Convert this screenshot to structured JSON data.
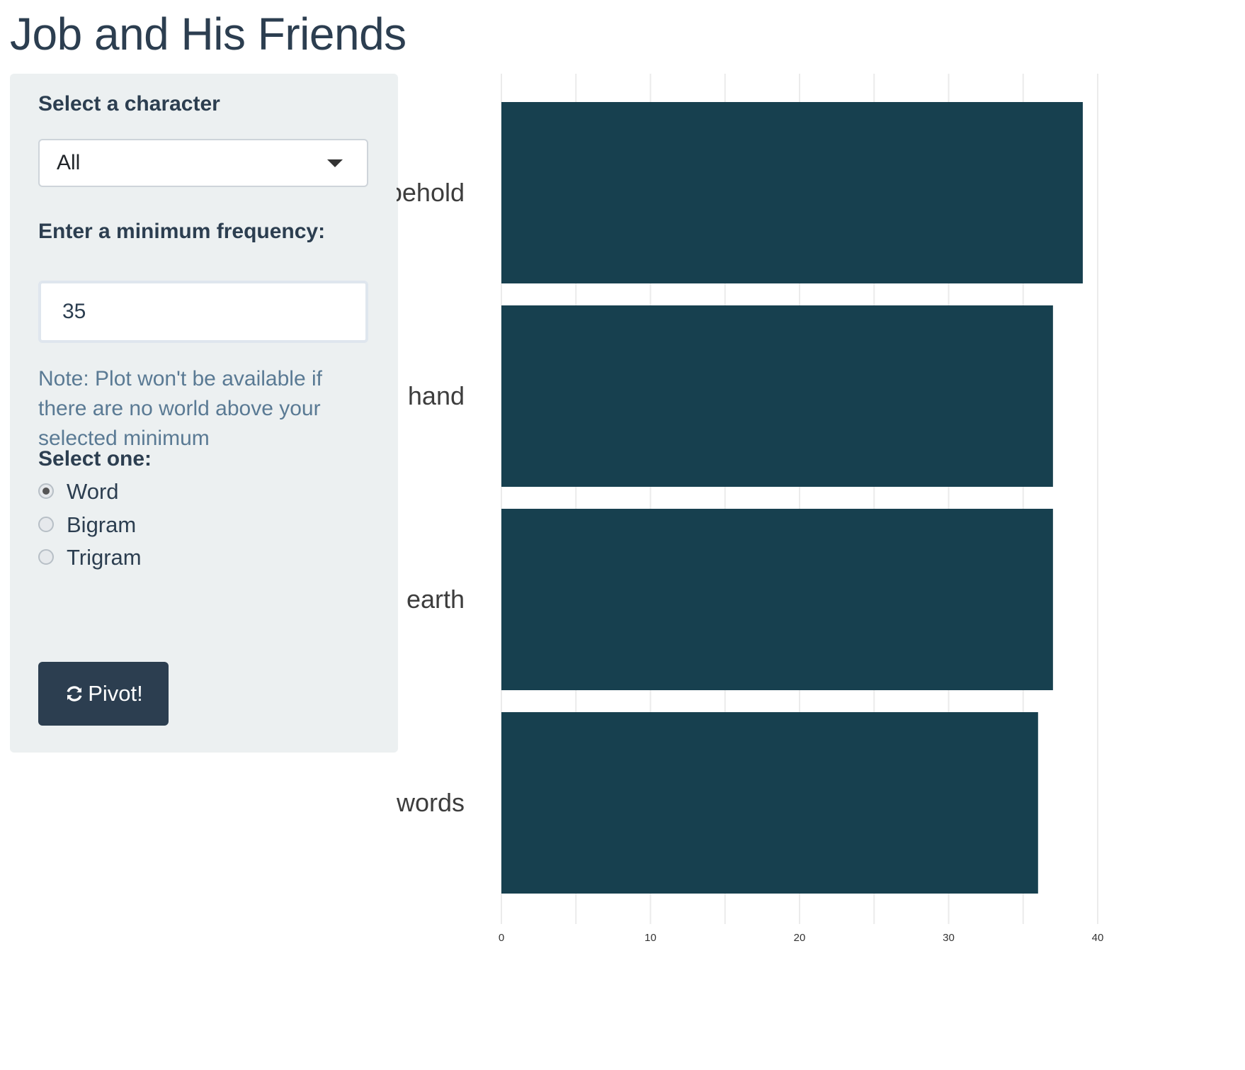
{
  "page": {
    "title": "Job and His Friends"
  },
  "sidebar": {
    "character": {
      "label": "Select a character",
      "value": "All"
    },
    "min_freq": {
      "label": "Enter a minimum frequency:",
      "value": "35"
    },
    "note": "Note: Plot won't be available if there are no world above your selected minimum",
    "ngram": {
      "label": "Select one:",
      "options": [
        {
          "label": "Word",
          "checked": true
        },
        {
          "label": "Bigram",
          "checked": false
        },
        {
          "label": "Trigram",
          "checked": false
        }
      ]
    },
    "button": {
      "label": "Pivot!",
      "icon": "refresh-icon"
    }
  },
  "colors": {
    "bar": "#17404f",
    "accent": "#2c3e50",
    "sidebar_bg": "#ecf0f1",
    "note": "#5a7a94"
  },
  "chart_data": {
    "type": "bar",
    "orientation": "horizontal",
    "categories": [
      "behold",
      "hand",
      "earth",
      "words"
    ],
    "values": [
      39,
      37,
      37,
      36
    ],
    "xlim": [
      0,
      40
    ],
    "xticks": [
      0,
      10,
      20,
      30,
      40
    ],
    "title": "",
    "xlabel": "",
    "ylabel": "",
    "grid": "vertical"
  }
}
